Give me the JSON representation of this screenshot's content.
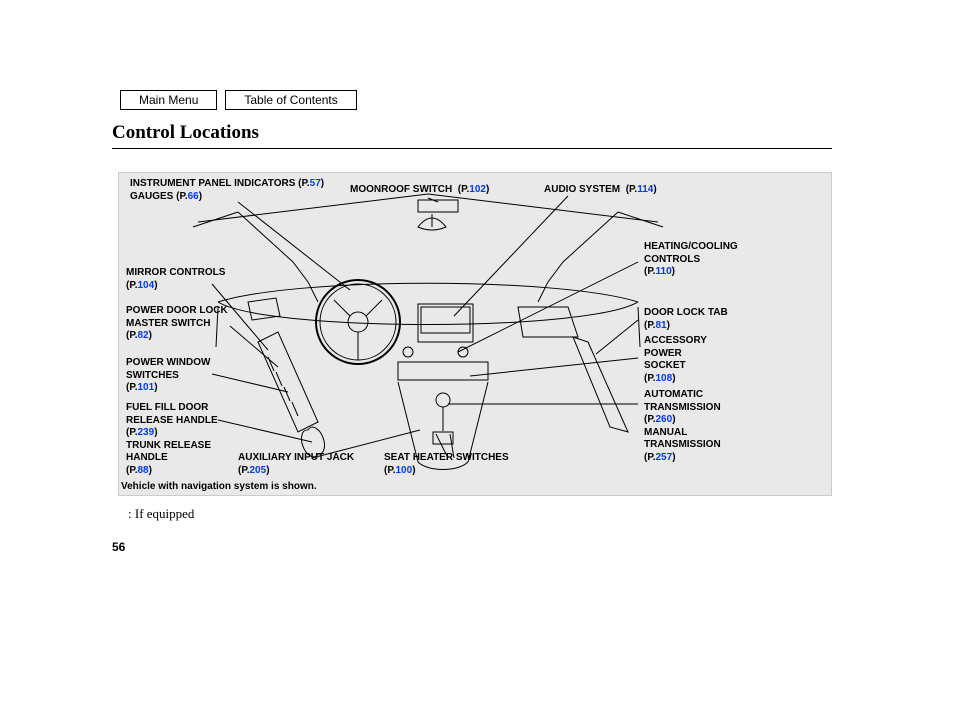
{
  "nav": {
    "main_menu": "Main Menu",
    "toc": "Table of Contents"
  },
  "title": "Control Locations",
  "labels": {
    "instrument": {
      "l1": "INSTRUMENT PANEL INDICATORS",
      "p1": "57",
      "l2": "GAUGES",
      "p2": "66"
    },
    "moonroof": {
      "l1": "MOONROOF SWITCH",
      "p1": "102"
    },
    "audio": {
      "l1": "AUDIO SYSTEM",
      "p1": "114"
    },
    "mirror": {
      "l1": "MIRROR CONTROLS",
      "p1": "104"
    },
    "lockmaster": {
      "l1": "POWER DOOR LOCK",
      "l2": "MASTER SWITCH",
      "p1": "82"
    },
    "pwindow": {
      "l1": "POWER WINDOW",
      "l2": "SWITCHES",
      "p1": "101"
    },
    "fuel": {
      "l1": "FUEL FILL DOOR",
      "l2": "RELEASE HANDLE",
      "p1": "239",
      "l3": "TRUNK RELEASE",
      "l4": "HANDLE",
      "p2": "88"
    },
    "aux": {
      "l1": "AUXILIARY INPUT JACK",
      "p1": "205"
    },
    "seatheat": {
      "l1": "SEAT HEATER SWITCHES",
      "p1": "100"
    },
    "heatcool": {
      "l1": "HEATING/COOLING",
      "l2": "CONTROLS",
      "p1": "110"
    },
    "locktab": {
      "l1": "DOOR LOCK TAB",
      "p1": "81"
    },
    "accpower": {
      "l1": "ACCESSORY",
      "l2": "POWER",
      "l3": "SOCKET",
      "p1": "108"
    },
    "trans": {
      "l1": "AUTOMATIC",
      "l2": "TRANSMISSION",
      "p1": "260",
      "l3": "MANUAL",
      "l4": "TRANSMISSION",
      "p2": "257"
    }
  },
  "note": "Vehicle with navigation system is shown.",
  "footnote": ":  If equipped",
  "page_number": "56"
}
